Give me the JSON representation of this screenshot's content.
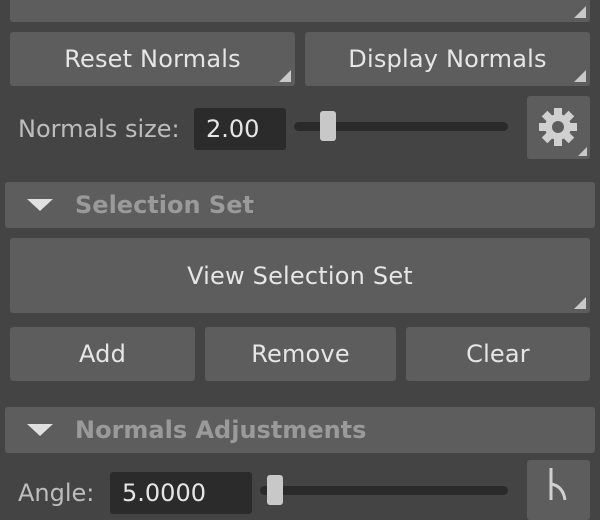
{
  "normals_row": {
    "reset_label": "Reset Normals",
    "display_label": "Display Normals"
  },
  "normals_size": {
    "label": "Normals size:",
    "value": "2.00",
    "slider_fraction": 0.13
  },
  "selection_set": {
    "title": "Selection Set",
    "view_label": "View Selection Set",
    "add_label": "Add",
    "remove_label": "Remove",
    "clear_label": "Clear"
  },
  "normals_adjustments": {
    "title": "Normals Adjustments",
    "angle_label": "Angle:",
    "angle_value": "5.0000",
    "slider_fraction": 0.03
  },
  "icons": {
    "settings": "gear-icon",
    "angle_tool": "angle-icon",
    "collapse": "triangle-down-icon",
    "corner": "corner-menu-indicator-icon"
  }
}
